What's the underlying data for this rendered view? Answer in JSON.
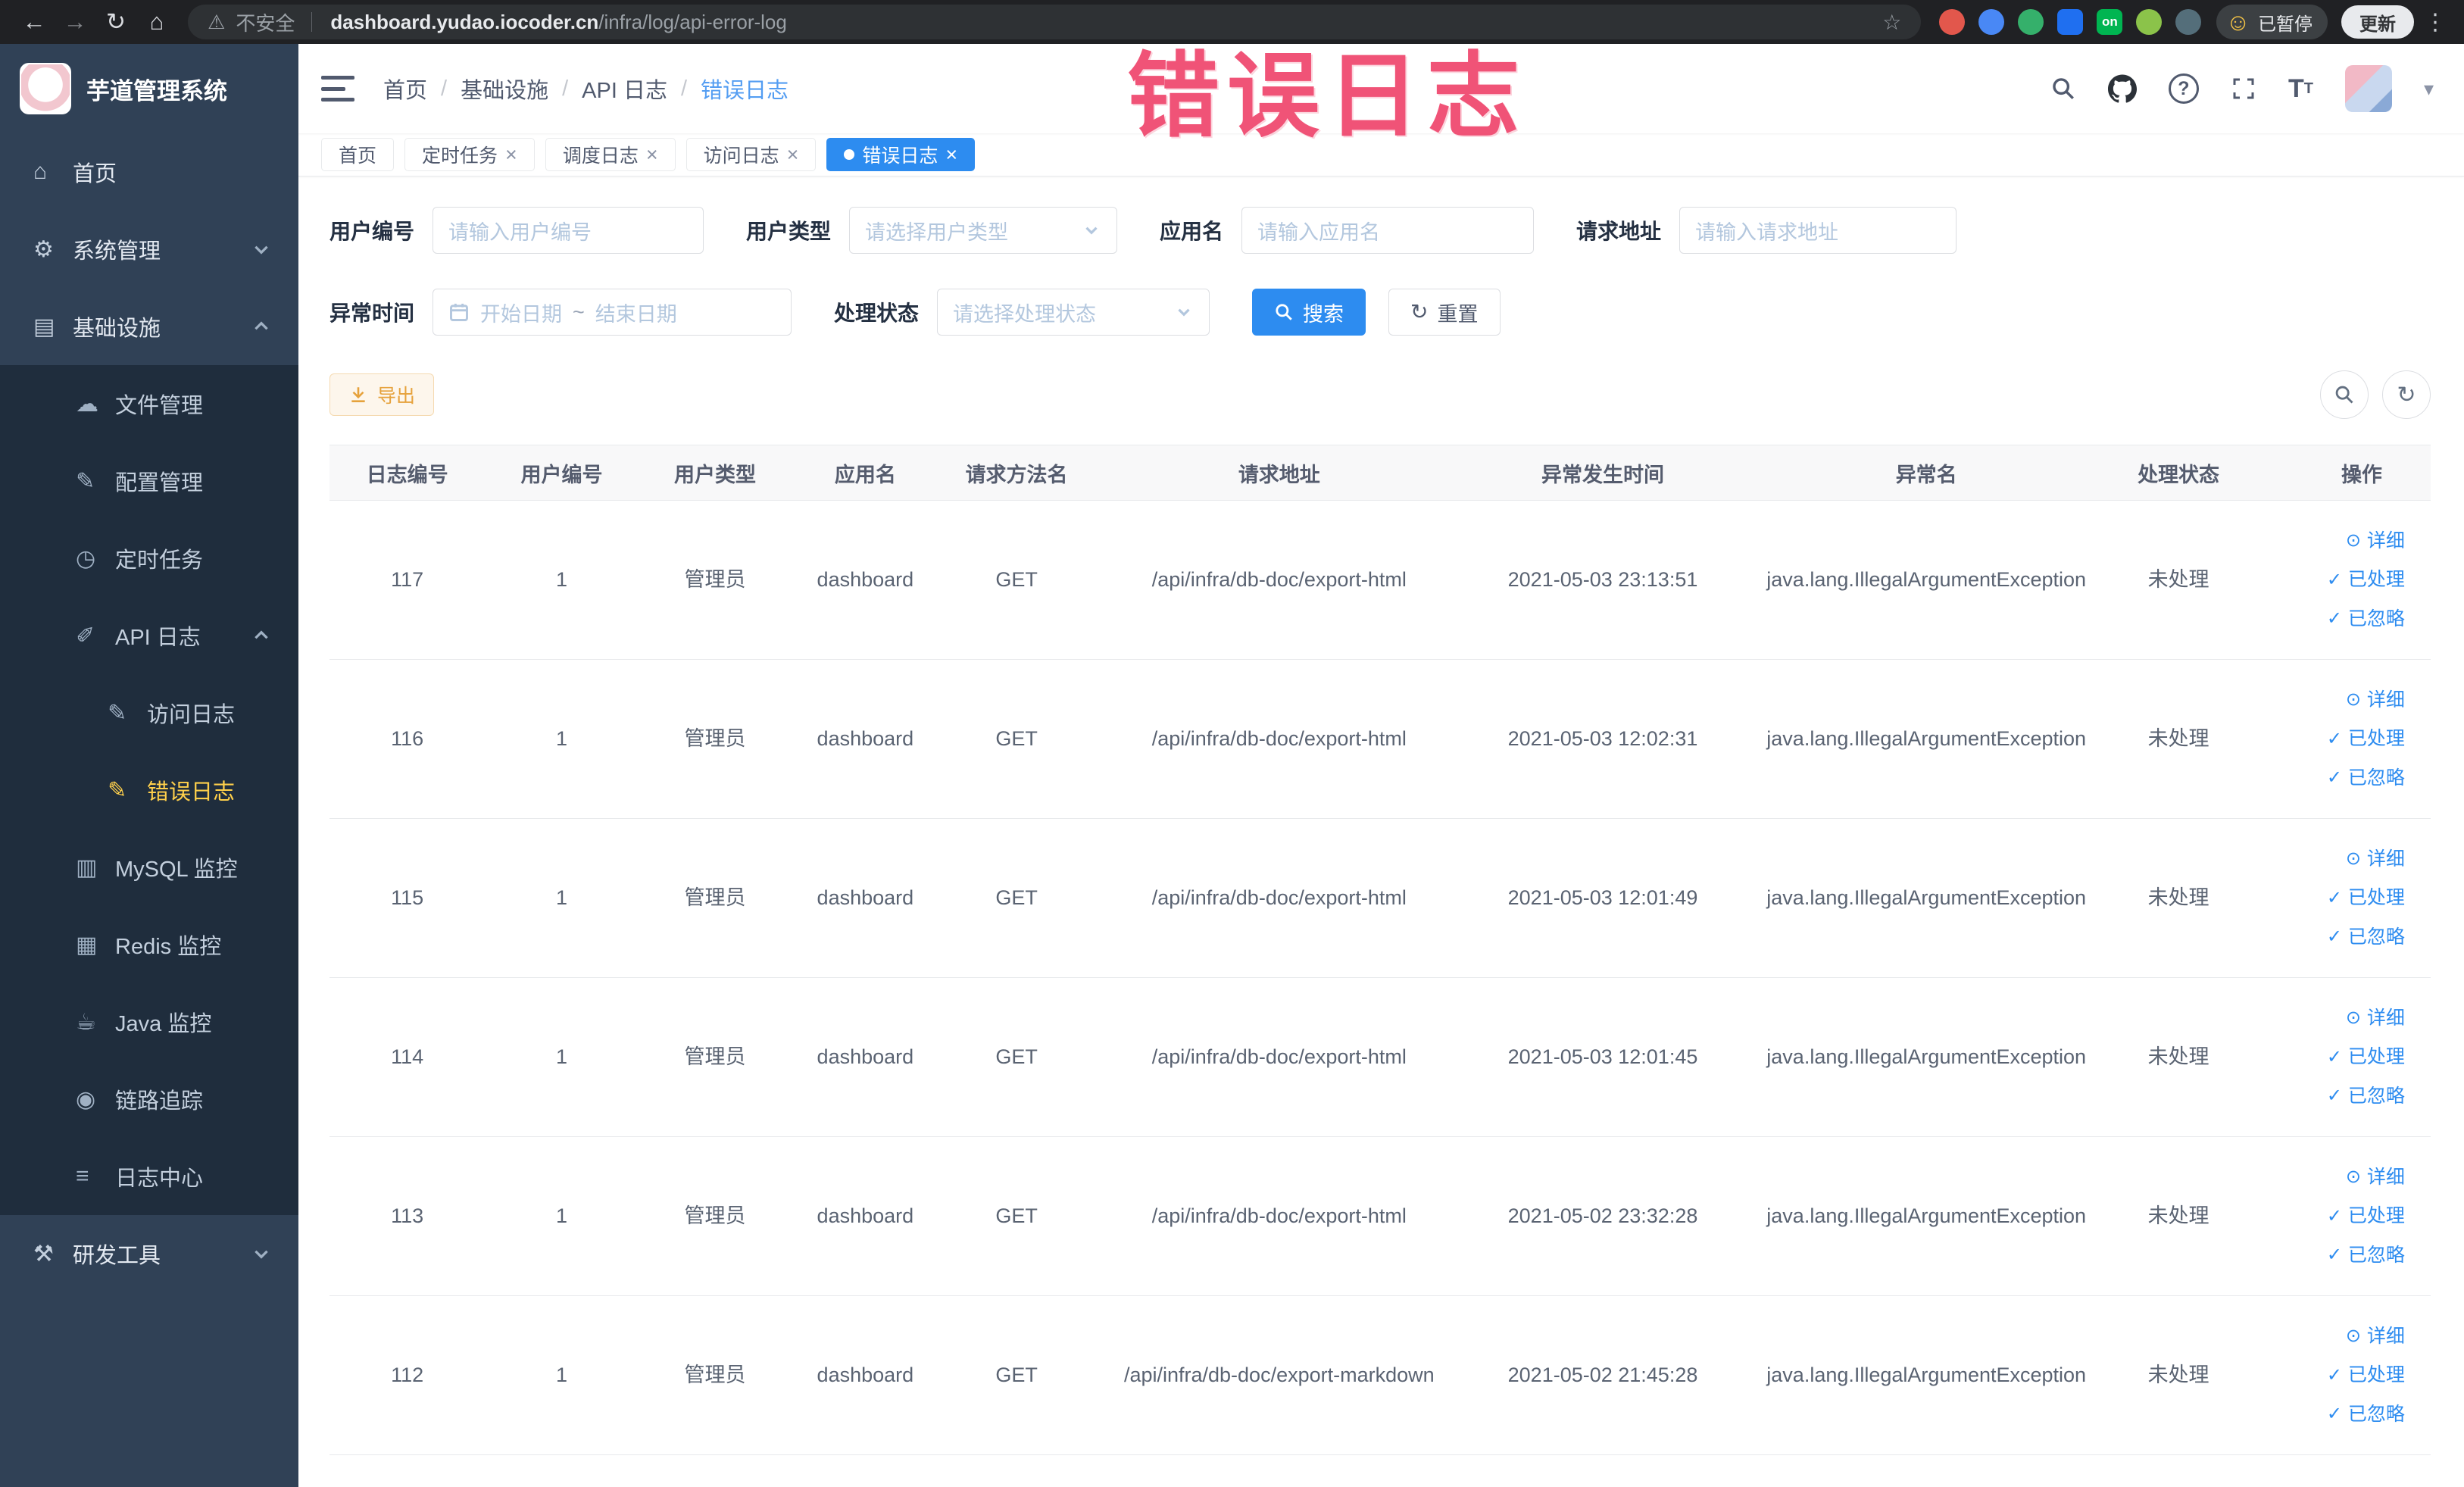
{
  "browser_chrome": {
    "security_label": "不安全",
    "url_domain": "dashboard.yudao.iocoder.cn",
    "url_path": "/infra/log/api-error-log",
    "ext_on_label": "on",
    "profile_status": "已暂停",
    "update_label": "更新"
  },
  "icons": {
    "back": "←",
    "forward": "→",
    "reload": "↻",
    "home": "⌂",
    "warning": "⚠",
    "star": "☆",
    "kebab": "⋮",
    "profile_emoji": "☺",
    "caret": "▾",
    "close": "×",
    "detail": "⊙",
    "check": "✓",
    "refresh": "↻"
  },
  "sidebar": {
    "app_title": "芋道管理系统",
    "items": [
      {
        "label": "首页",
        "icon": "home-icon",
        "glyph": "⌂",
        "level": 1
      },
      {
        "label": "系统管理",
        "icon": "settings-icon",
        "glyph": "⚙",
        "level": 1,
        "chevron": "down"
      },
      {
        "label": "基础设施",
        "icon": "infrastructure-icon",
        "glyph": "▤",
        "level": 1,
        "chevron": "up"
      },
      {
        "label": "文件管理",
        "icon": "file-manage-icon",
        "glyph": "☁",
        "level": 2
      },
      {
        "label": "配置管理",
        "icon": "config-manage-icon",
        "glyph": "✎",
        "level": 2
      },
      {
        "label": "定时任务",
        "icon": "scheduled-task-icon",
        "glyph": "◷",
        "level": 2
      },
      {
        "label": "API 日志",
        "icon": "api-log-icon",
        "glyph": "✐",
        "level": 2,
        "chevron": "up"
      },
      {
        "label": "访问日志",
        "icon": "access-log-icon",
        "glyph": "✎",
        "level": 3
      },
      {
        "label": "错误日志",
        "icon": "error-log-icon",
        "glyph": "✎",
        "level": 3,
        "active": true
      },
      {
        "label": "MySQL 监控",
        "icon": "mysql-monitor-icon",
        "glyph": "▥",
        "level": 2
      },
      {
        "label": "Redis 监控",
        "icon": "redis-monitor-icon",
        "glyph": "▦",
        "level": 2
      },
      {
        "label": "Java 监控",
        "icon": "java-monitor-icon",
        "glyph": "☕",
        "level": 2
      },
      {
        "label": "链路追踪",
        "icon": "trace-icon",
        "glyph": "◉",
        "level": 2
      },
      {
        "label": "日志中心",
        "icon": "log-center-icon",
        "glyph": "≡",
        "level": 2
      },
      {
        "label": "研发工具",
        "icon": "dev-tools-icon",
        "glyph": "⚒",
        "level": 1,
        "chevron": "down"
      }
    ]
  },
  "app_header": {
    "breadcrumb": [
      "首页",
      "基础设施",
      "API 日志",
      "错误日志"
    ]
  },
  "tabs": [
    {
      "label": "首页",
      "closable": false,
      "active": false
    },
    {
      "label": "定时任务",
      "closable": true,
      "active": false
    },
    {
      "label": "调度日志",
      "closable": true,
      "active": false
    },
    {
      "label": "访问日志",
      "closable": true,
      "active": false
    },
    {
      "label": "错误日志",
      "closable": true,
      "active": true
    }
  ],
  "filters": {
    "user_id": {
      "label": "用户编号",
      "placeholder": "请输入用户编号"
    },
    "user_type": {
      "label": "用户类型",
      "placeholder": "请选择用户类型"
    },
    "app_name": {
      "label": "应用名",
      "placeholder": "请输入应用名"
    },
    "request_url": {
      "label": "请求地址",
      "placeholder": "请输入请求地址"
    },
    "exception_time": {
      "label": "异常时间",
      "start_placeholder": "开始日期",
      "separator": "~",
      "end_placeholder": "结束日期"
    },
    "process_status": {
      "label": "处理状态",
      "placeholder": "请选择处理状态"
    },
    "search_label": "搜索",
    "reset_label": "重置"
  },
  "toolbar": {
    "export_label": "导出"
  },
  "table": {
    "columns": [
      "日志编号",
      "用户编号",
      "用户类型",
      "应用名",
      "请求方法名",
      "请求地址",
      "异常发生时间",
      "异常名",
      "处理状态",
      "操作"
    ],
    "action_labels": {
      "detail": "详细",
      "processed": "已处理",
      "ignored": "已忽略"
    },
    "rows": [
      {
        "id": "117",
        "user_id": "1",
        "user_type": "管理员",
        "app": "dashboard",
        "method": "GET",
        "url": "/api/infra/db-doc/export-html",
        "time": "2021-05-03 23:13:51",
        "exception": "java.lang.IllegalArgumentException",
        "status": "未处理"
      },
      {
        "id": "116",
        "user_id": "1",
        "user_type": "管理员",
        "app": "dashboard",
        "method": "GET",
        "url": "/api/infra/db-doc/export-html",
        "time": "2021-05-03 12:02:31",
        "exception": "java.lang.IllegalArgumentException",
        "status": "未处理"
      },
      {
        "id": "115",
        "user_id": "1",
        "user_type": "管理员",
        "app": "dashboard",
        "method": "GET",
        "url": "/api/infra/db-doc/export-html",
        "time": "2021-05-03 12:01:49",
        "exception": "java.lang.IllegalArgumentException",
        "status": "未处理"
      },
      {
        "id": "114",
        "user_id": "1",
        "user_type": "管理员",
        "app": "dashboard",
        "method": "GET",
        "url": "/api/infra/db-doc/export-html",
        "time": "2021-05-03 12:01:45",
        "exception": "java.lang.IllegalArgumentException",
        "status": "未处理"
      },
      {
        "id": "113",
        "user_id": "1",
        "user_type": "管理员",
        "app": "dashboard",
        "method": "GET",
        "url": "/api/infra/db-doc/export-html",
        "time": "2021-05-02 23:32:28",
        "exception": "java.lang.IllegalArgumentException",
        "status": "未处理"
      },
      {
        "id": "112",
        "user_id": "1",
        "user_type": "管理员",
        "app": "dashboard",
        "method": "GET",
        "url": "/api/infra/db-doc/export-markdown",
        "time": "2021-05-02 21:45:28",
        "exception": "java.lang.IllegalArgumentException",
        "status": "未处理"
      }
    ]
  },
  "annotation": {
    "text": "错误日志"
  },
  "colors": {
    "primary": "#2d8cf0",
    "sidebar_bg": "#304156",
    "submenu_bg": "#1f2d3d",
    "active_menu_text": "#ffd04b",
    "export_text": "#e6a23c",
    "annotation_red": "#ef466d"
  }
}
